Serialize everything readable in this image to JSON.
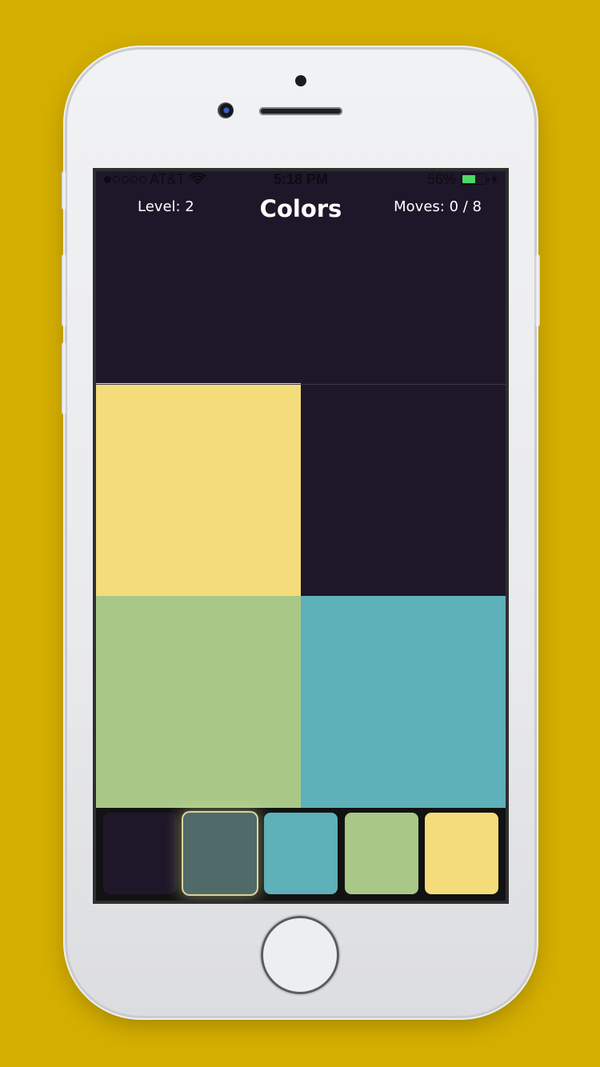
{
  "status_bar": {
    "carrier": "AT&T",
    "time": "5:18 PM",
    "battery_percent": "56%",
    "battery_level": 0.56,
    "signal_bars_filled": 1,
    "signal_bars_total": 5,
    "icons": [
      "wifi-icon",
      "battery-icon",
      "charging-bolt-icon"
    ]
  },
  "hud": {
    "level": "Level: 2",
    "title": "Colors",
    "moves": "Moves: 0 / 8"
  },
  "board": {
    "rows": 3,
    "cols": 2,
    "cells": [
      {
        "name": "cell-r1-c1",
        "color": "#1e1729"
      },
      {
        "name": "cell-r1-c2",
        "color": "#1e1729"
      },
      {
        "name": "cell-r2-c1",
        "color": "#f4dc7a"
      },
      {
        "name": "cell-r2-c2",
        "color": "#1e1729"
      },
      {
        "name": "cell-r3-c1",
        "color": "#a9c888"
      },
      {
        "name": "cell-r3-c2",
        "color": "#5eb0b9"
      }
    ]
  },
  "palette": {
    "selected_index": 1,
    "swatches": [
      {
        "name": "swatch-dark-purple",
        "color": "#1e1729"
      },
      {
        "name": "swatch-slate",
        "color": "#506a6a"
      },
      {
        "name": "swatch-teal",
        "color": "#5eb0b9"
      },
      {
        "name": "swatch-green",
        "color": "#a9c888"
      },
      {
        "name": "swatch-yellow",
        "color": "#f4dc7a"
      }
    ]
  },
  "theme": {
    "background": "#d4ae00",
    "screen_bg": "#1e1729"
  }
}
